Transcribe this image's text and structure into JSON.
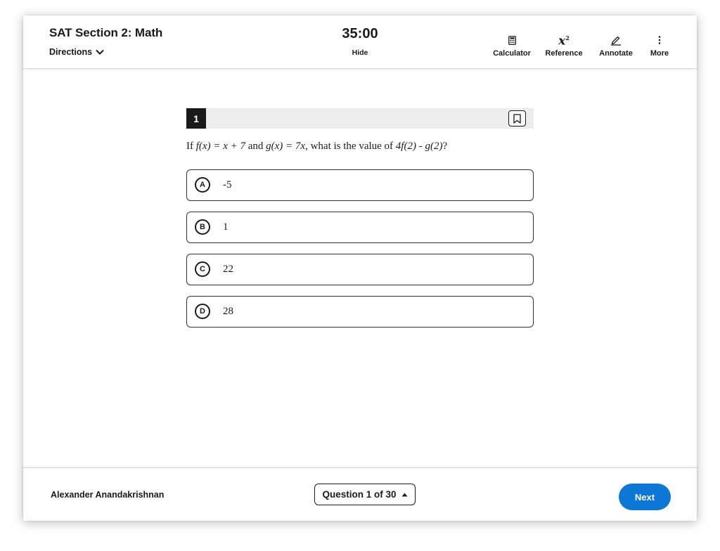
{
  "header": {
    "section_title": "SAT Section 2: Math",
    "directions_label": "Directions",
    "timer": "35:00",
    "hide_label": "Hide",
    "tools": {
      "calculator": "Calculator",
      "reference": "Reference",
      "reference_symbol": "x",
      "reference_sup": "2",
      "annotate": "Annotate",
      "more": "More"
    }
  },
  "question": {
    "number": "1",
    "text": {
      "p1": "If ",
      "f": "f(x) = x + 7",
      "p2": " and ",
      "g": "g(x) = 7x",
      "p3": ", what is the value of ",
      "expr": "4f(2) - g(2)",
      "p4": "?"
    },
    "choices": [
      {
        "letter": "A",
        "value": "-5"
      },
      {
        "letter": "B",
        "value": "1"
      },
      {
        "letter": "C",
        "value": "22"
      },
      {
        "letter": "D",
        "value": "28"
      }
    ]
  },
  "footer": {
    "student_name": "Alexander Anandakrishnan",
    "question_nav": "Question 1 of 30",
    "next_label": "Next"
  },
  "icons": {
    "directions": "chevron-down-icon",
    "calculator": "calculator-icon",
    "reference": "formula-icon",
    "annotate": "pen-icon",
    "more": "vertical-dots-icon",
    "bookmark": "bookmark-icon",
    "question_nav": "caret-up-icon"
  },
  "colors": {
    "accent": "#0c77d4",
    "text": "#1a1a1a",
    "question_bar": "#ededed"
  }
}
